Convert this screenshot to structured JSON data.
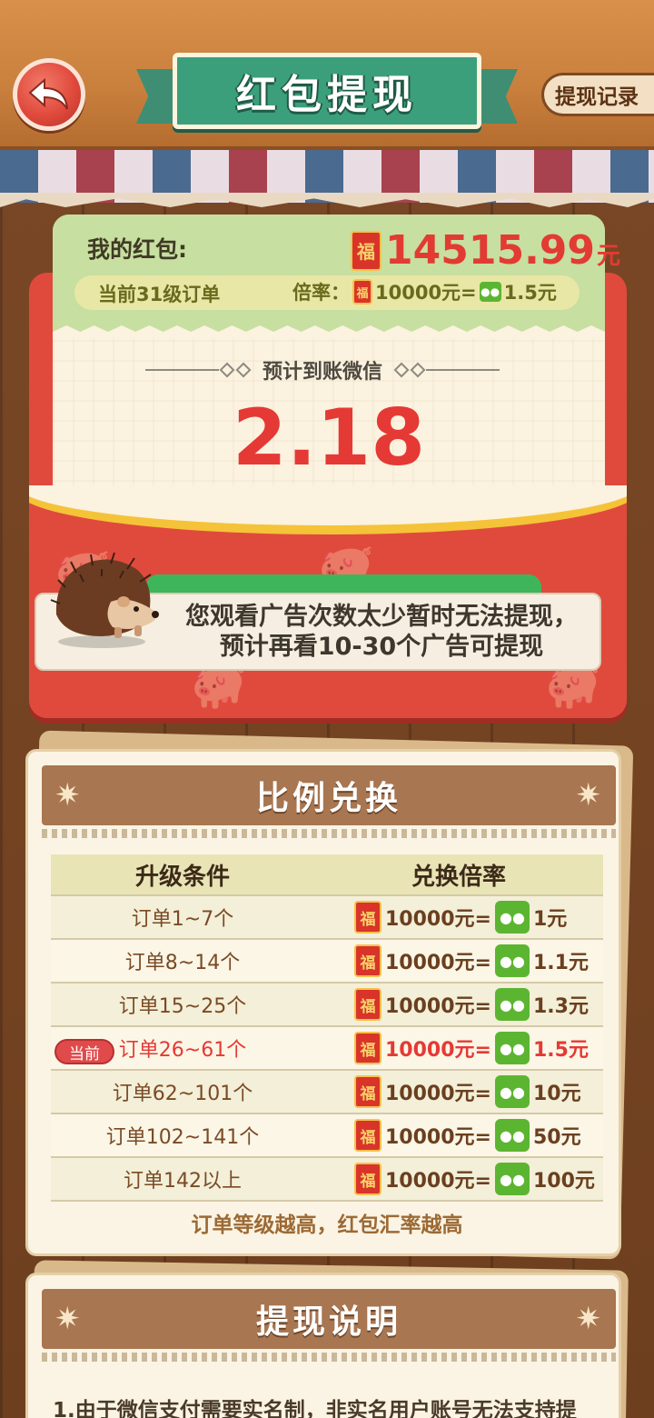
{
  "header": {
    "title": "红包提现",
    "record_label": "提现记录"
  },
  "wallet": {
    "label": "我的红包:",
    "balance": "14515.99",
    "unit": "元",
    "level_text": "当前31级订单",
    "rate_label": "倍率：",
    "rate_from": "10000元=",
    "rate_to": "1.5元"
  },
  "expect": {
    "label": "预计到账微信",
    "amount": "2.18"
  },
  "toast": {
    "message": "您观看广告次数太少暂时无法提现，预计再看10-30个广告可提现"
  },
  "exchange": {
    "title": "比例兑换",
    "col_condition": "升级条件",
    "col_rate": "兑换倍率",
    "current_badge": "当前",
    "rows": [
      {
        "condition": "订单1~7个",
        "from": "10000元=",
        "to": "1元"
      },
      {
        "condition": "订单8~14个",
        "from": "10000元=",
        "to": "1.1元"
      },
      {
        "condition": "订单15~25个",
        "from": "10000元=",
        "to": "1.3元"
      },
      {
        "condition": "订单26~61个",
        "from": "10000元=",
        "to": "1.5元"
      },
      {
        "condition": "订单62~101个",
        "from": "10000元=",
        "to": "10元"
      },
      {
        "condition": "订单102~141个",
        "from": "10000元=",
        "to": "50元"
      },
      {
        "condition": "订单142以上",
        "from": "10000元=",
        "to": "100元"
      }
    ],
    "tip": "订单等级越高，红包汇率越高"
  },
  "explain": {
    "title": "提现说明",
    "line1": "1.由于微信支付需要实名制，非实名用户账号无法支持提"
  },
  "icons": {
    "fu_char": "福",
    "back": "back-arrow-icon",
    "wechat": "wechat-icon"
  },
  "colors": {
    "accent_red": "#e53935",
    "title_green": "#3c9f7c",
    "wechat_green": "#5cb531"
  }
}
